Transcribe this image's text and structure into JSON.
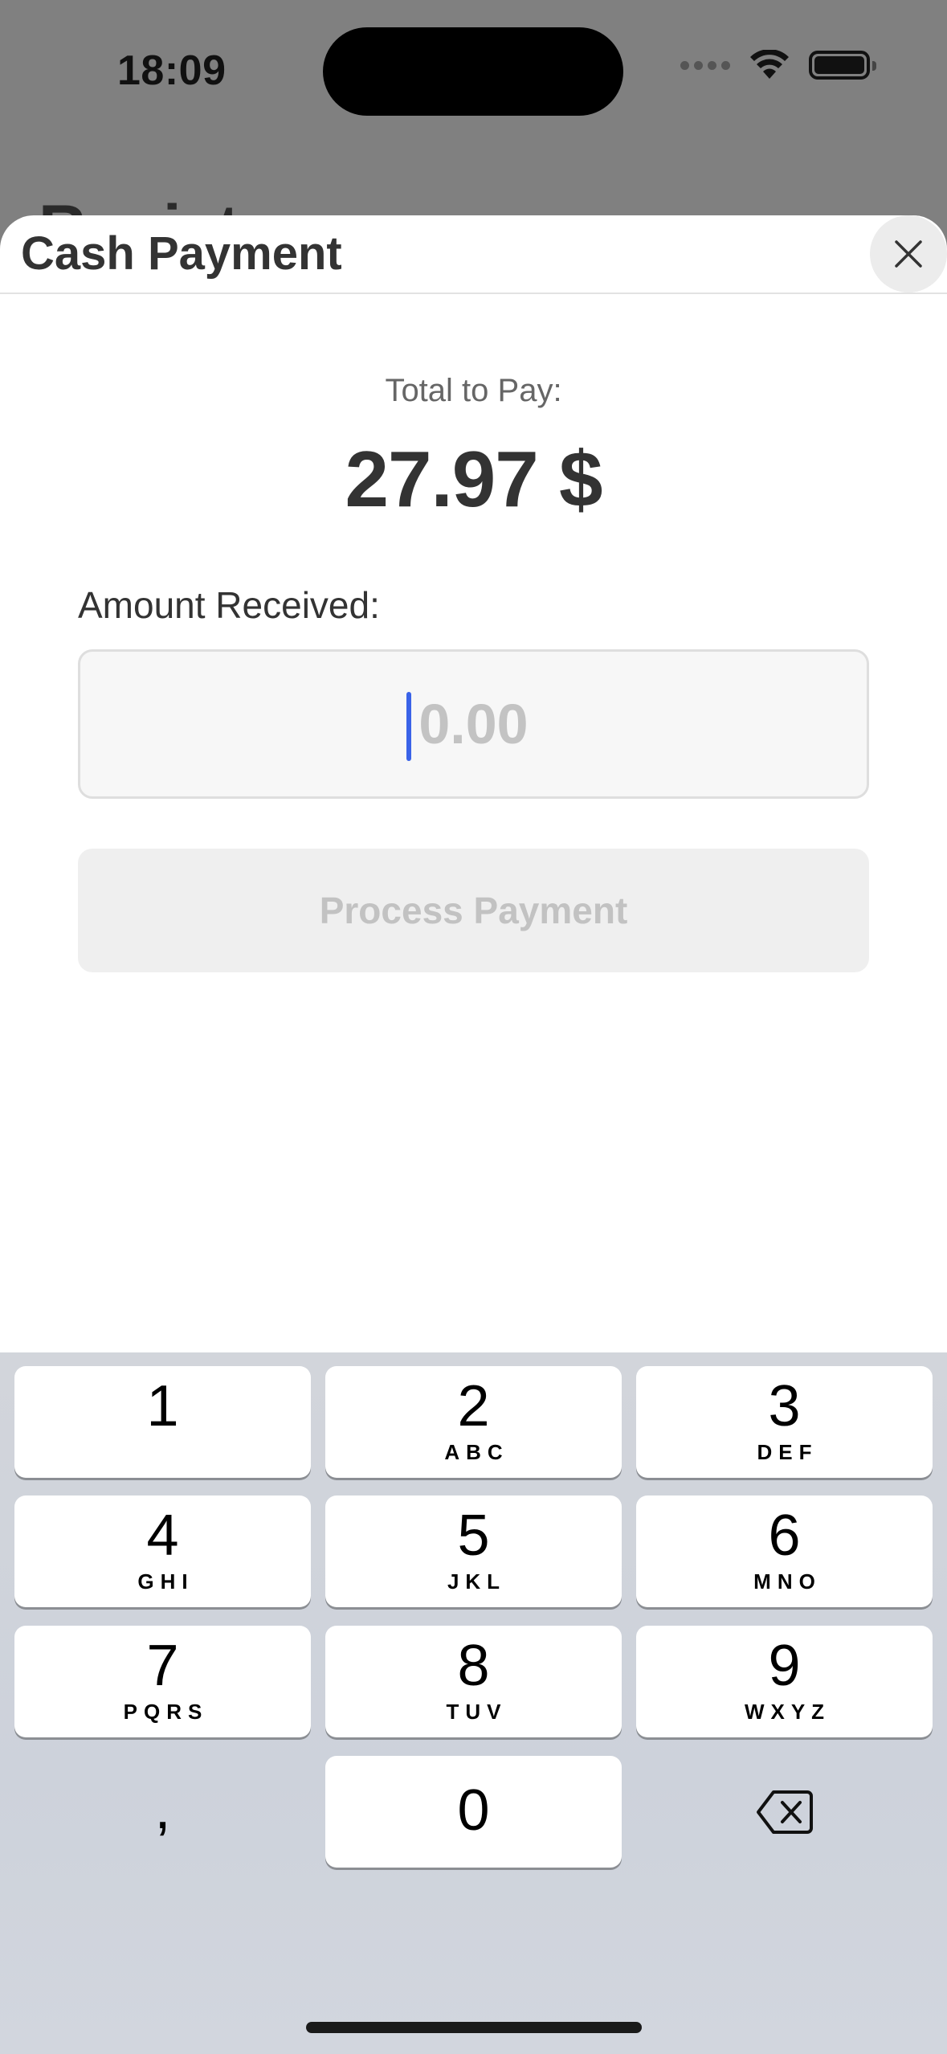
{
  "status_bar": {
    "time": "18:09"
  },
  "background": {
    "title": "Register"
  },
  "sheet": {
    "title": "Cash Payment",
    "close_icon": "close-icon"
  },
  "payment": {
    "total_label": "Total to Pay:",
    "total_amount": "27.97 $",
    "amount_label": "Amount Received:",
    "amount_placeholder": "0.00",
    "amount_value": "",
    "process_button_label": "Process Payment",
    "process_button_enabled": false
  },
  "keyboard": {
    "keys": [
      {
        "digit": "1",
        "letters": ""
      },
      {
        "digit": "2",
        "letters": "ABC"
      },
      {
        "digit": "3",
        "letters": "DEF"
      },
      {
        "digit": "4",
        "letters": "GHI"
      },
      {
        "digit": "5",
        "letters": "JKL"
      },
      {
        "digit": "6",
        "letters": "MNO"
      },
      {
        "digit": "7",
        "letters": "PQRS"
      },
      {
        "digit": "8",
        "letters": "TUV"
      },
      {
        "digit": "9",
        "letters": "WXYZ"
      },
      {
        "digit": ",",
        "letters": ""
      },
      {
        "digit": "0",
        "letters": ""
      },
      {
        "digit": "",
        "letters": "",
        "icon": "backspace-icon"
      }
    ]
  },
  "colors": {
    "accent_caret": "#3a63e8",
    "sheet_background": "#ffffff",
    "dimmed_backdrop": "#808080",
    "disabled_button_bg": "#efefef",
    "disabled_button_text": "#c2c2c2"
  }
}
